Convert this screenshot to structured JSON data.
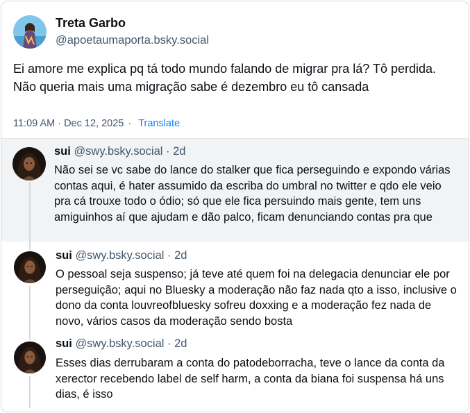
{
  "post": {
    "author_name": "Treta Garbo",
    "author_handle": "@apoetaumaporta.bsky.social",
    "text": "Ei amore me explica pq tá todo mundo falando de migrar pra lá? Tô perdida. Não queria mais uma migração sabe é dezembro eu tô cansada",
    "timestamp": "11:09 AM · Dec 12, 2025",
    "separator": "·",
    "translate_label": "Translate"
  },
  "replies": [
    {
      "name": "sui",
      "handle": "@swy.bsky.social",
      "age": "· 2d",
      "text": "Não sei se vc sabe do lance do stalker que fica perseguindo e expondo várias contas aqui, é hater assumido da escriba do umbral no twitter e qdo ele veio pra cá trouxe todo o ódio; só que ele fica persuindo mais gente, tem uns amiguinhos aí que ajudam e dão palco, ficam denunciando contas pra que"
    },
    {
      "name": "sui",
      "handle": "@swy.bsky.social",
      "age": "· 2d",
      "text": "O pessoal seja suspenso; já teve até quem foi na delegacia denunciar ele por perseguição; aqui no Bluesky a moderação não faz nada qto a isso, inclusive o dono da conta louvreofbluesky sofreu doxxing e a moderação fez nada de novo, vários casos da moderação sendo bosta"
    },
    {
      "name": "sui",
      "handle": "@swy.bsky.social",
      "age": "· 2d",
      "text": "Esses dias derrubaram a conta do patodeborracha, teve o lance da conta da xerector recebendo label de self harm, a conta da biana foi suspensa há uns dias, é isso"
    }
  ],
  "colors": {
    "text": "#0b0f14",
    "muted": "#42576c",
    "link": "#1083fe",
    "highlight_bg": "#f1f3f5",
    "border": "#d4dbe2"
  }
}
